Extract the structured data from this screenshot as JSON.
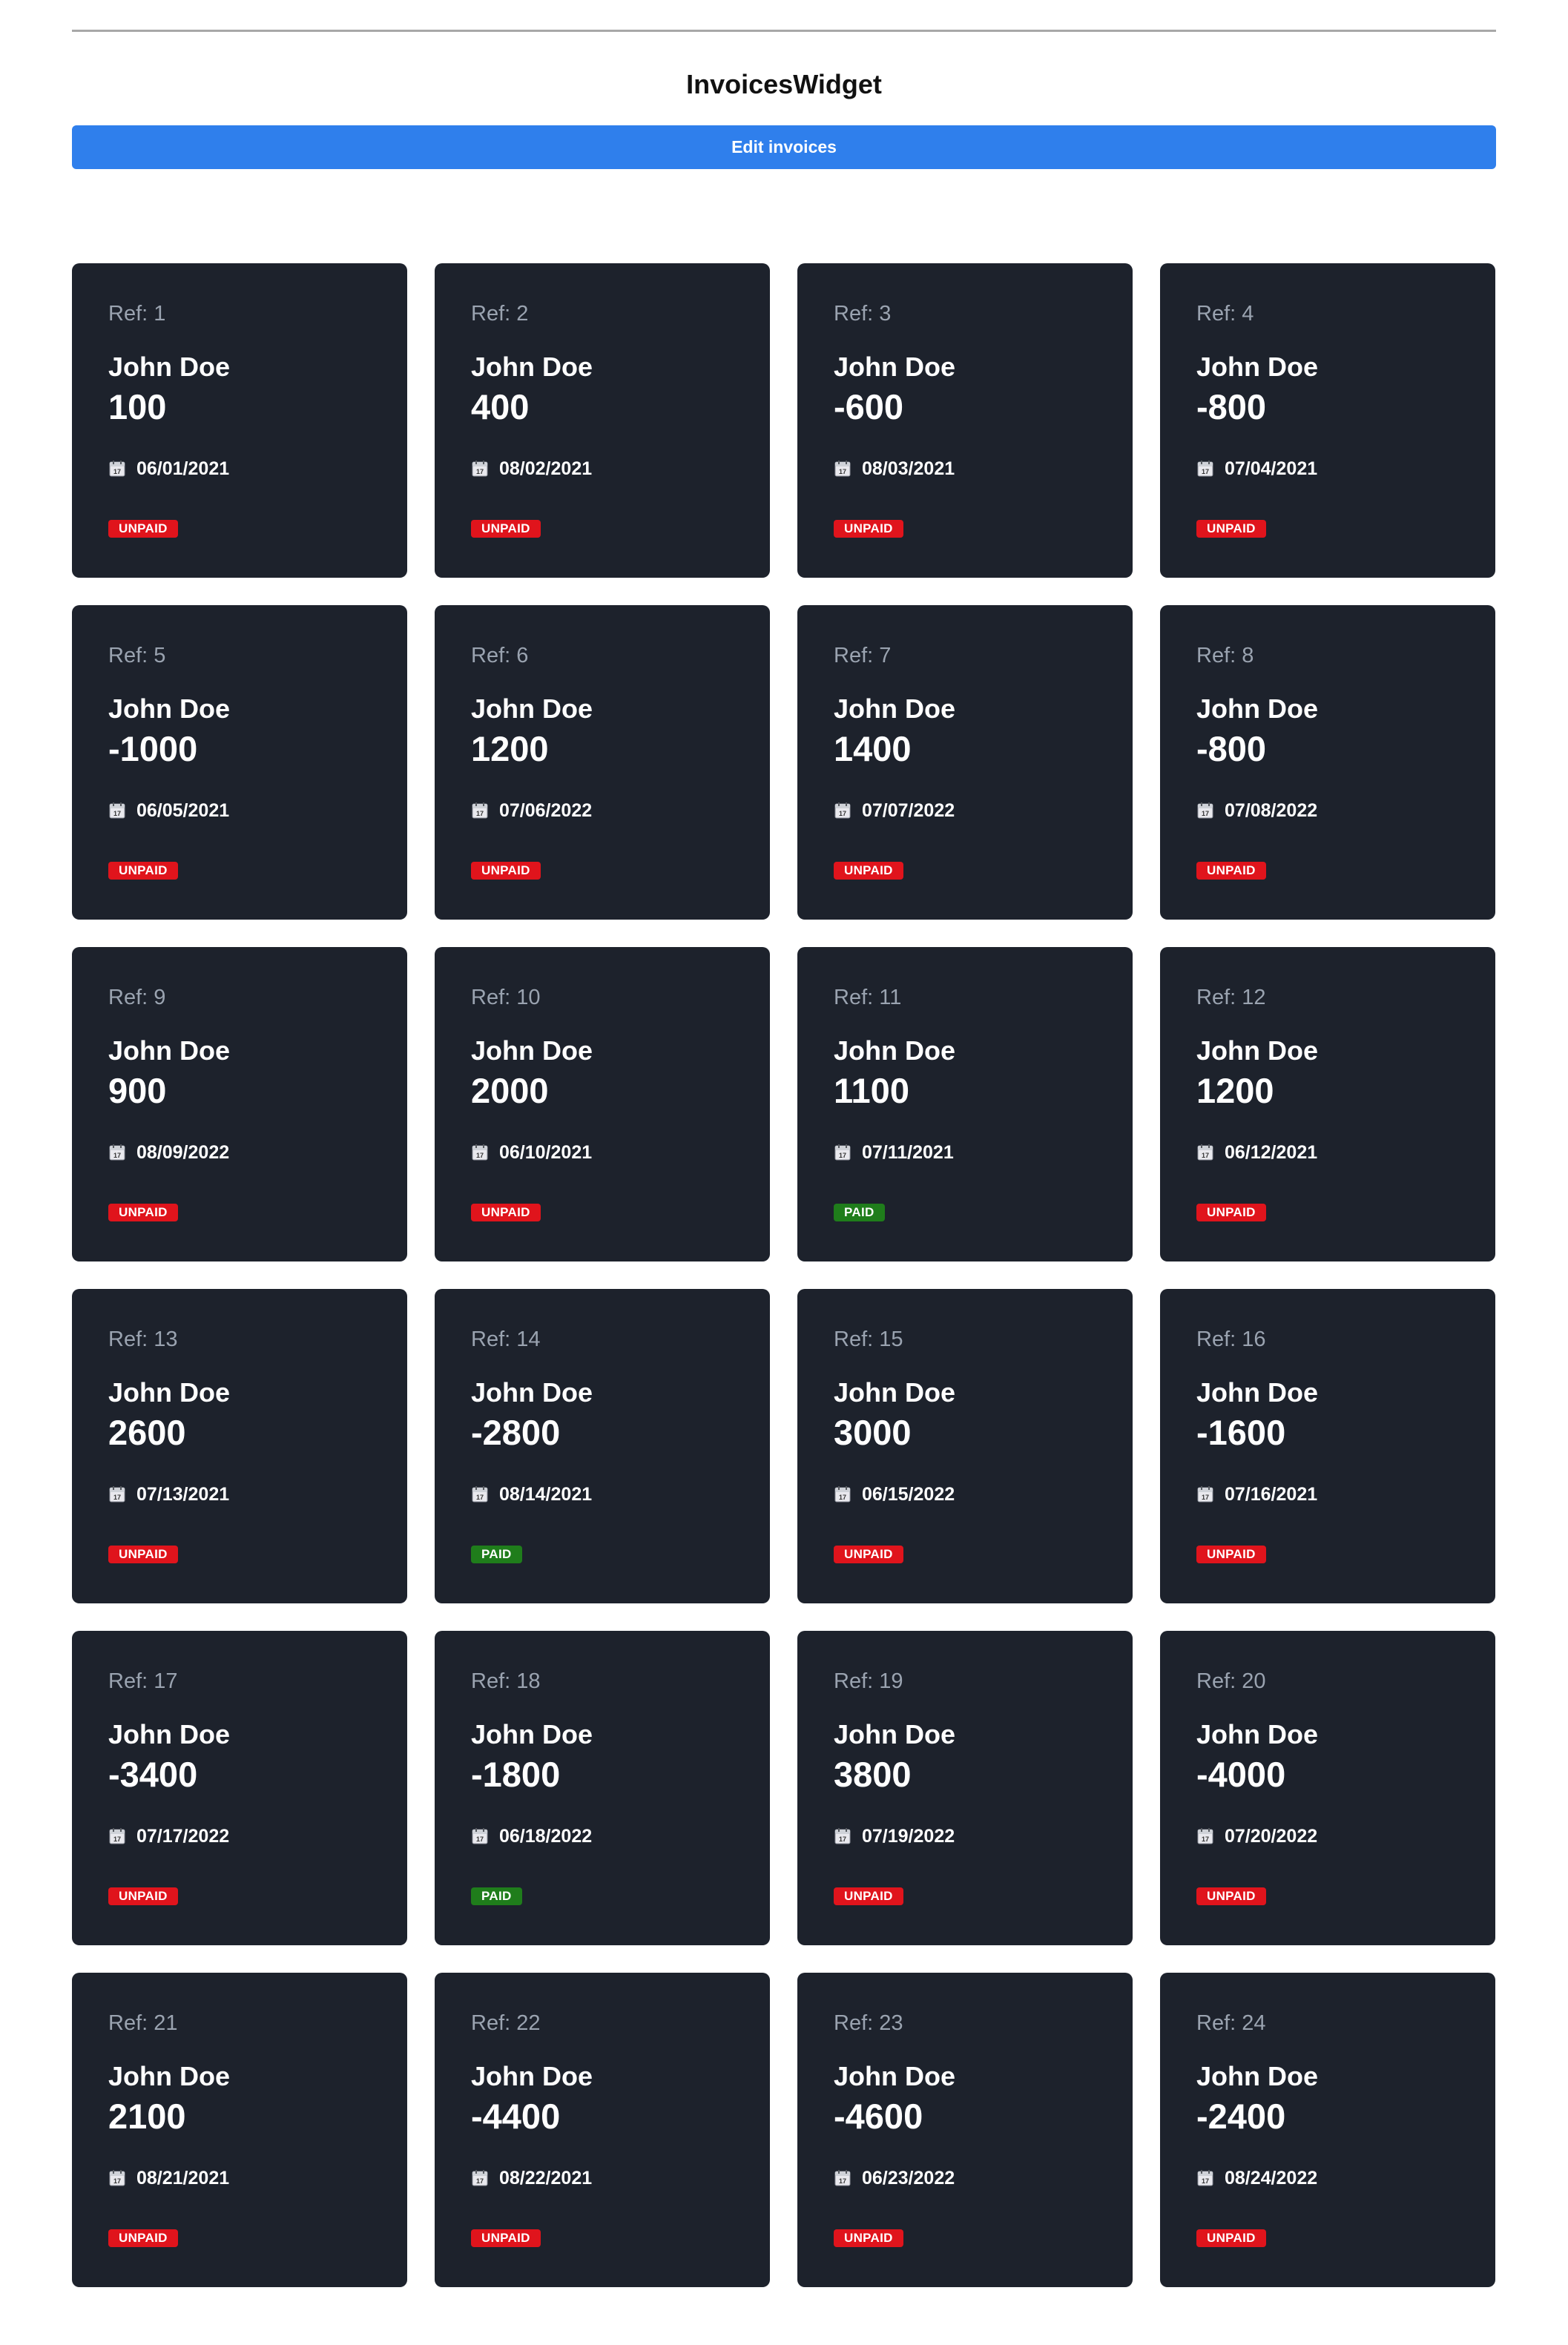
{
  "header": {
    "title": "InvoicesWidget",
    "edit_button_label": "Edit invoices"
  },
  "colors": {
    "accent": "#2f7fec",
    "card_background": "#1d222c",
    "unpaid": "#e0141c",
    "paid": "#1f7d1b"
  },
  "icons": {
    "date": "calendar-icon"
  },
  "invoices": [
    {
      "ref": "Ref: 1",
      "name": "John Doe",
      "amount": "100",
      "date": "06/01/2021",
      "status": "UNPAID"
    },
    {
      "ref": "Ref: 2",
      "name": "John Doe",
      "amount": "400",
      "date": "08/02/2021",
      "status": "UNPAID"
    },
    {
      "ref": "Ref: 3",
      "name": "John Doe",
      "amount": "-600",
      "date": "08/03/2021",
      "status": "UNPAID"
    },
    {
      "ref": "Ref: 4",
      "name": "John Doe",
      "amount": "-800",
      "date": "07/04/2021",
      "status": "UNPAID"
    },
    {
      "ref": "Ref: 5",
      "name": "John Doe",
      "amount": "-1000",
      "date": "06/05/2021",
      "status": "UNPAID"
    },
    {
      "ref": "Ref: 6",
      "name": "John Doe",
      "amount": "1200",
      "date": "07/06/2022",
      "status": "UNPAID"
    },
    {
      "ref": "Ref: 7",
      "name": "John Doe",
      "amount": "1400",
      "date": "07/07/2022",
      "status": "UNPAID"
    },
    {
      "ref": "Ref: 8",
      "name": "John Doe",
      "amount": "-800",
      "date": "07/08/2022",
      "status": "UNPAID"
    },
    {
      "ref": "Ref: 9",
      "name": "John Doe",
      "amount": "900",
      "date": "08/09/2022",
      "status": "UNPAID"
    },
    {
      "ref": "Ref: 10",
      "name": "John Doe",
      "amount": "2000",
      "date": "06/10/2021",
      "status": "UNPAID"
    },
    {
      "ref": "Ref: 11",
      "name": "John Doe",
      "amount": "1100",
      "date": "07/11/2021",
      "status": "PAID"
    },
    {
      "ref": "Ref: 12",
      "name": "John Doe",
      "amount": "1200",
      "date": "06/12/2021",
      "status": "UNPAID"
    },
    {
      "ref": "Ref: 13",
      "name": "John Doe",
      "amount": "2600",
      "date": "07/13/2021",
      "status": "UNPAID"
    },
    {
      "ref": "Ref: 14",
      "name": "John Doe",
      "amount": "-2800",
      "date": "08/14/2021",
      "status": "PAID"
    },
    {
      "ref": "Ref: 15",
      "name": "John Doe",
      "amount": "3000",
      "date": "06/15/2022",
      "status": "UNPAID"
    },
    {
      "ref": "Ref: 16",
      "name": "John Doe",
      "amount": "-1600",
      "date": "07/16/2021",
      "status": "UNPAID"
    },
    {
      "ref": "Ref: 17",
      "name": "John Doe",
      "amount": "-3400",
      "date": "07/17/2022",
      "status": "UNPAID"
    },
    {
      "ref": "Ref: 18",
      "name": "John Doe",
      "amount": "-1800",
      "date": "06/18/2022",
      "status": "PAID"
    },
    {
      "ref": "Ref: 19",
      "name": "John Doe",
      "amount": "3800",
      "date": "07/19/2022",
      "status": "UNPAID"
    },
    {
      "ref": "Ref: 20",
      "name": "John Doe",
      "amount": "-4000",
      "date": "07/20/2022",
      "status": "UNPAID"
    },
    {
      "ref": "Ref: 21",
      "name": "John Doe",
      "amount": "2100",
      "date": "08/21/2021",
      "status": "UNPAID"
    },
    {
      "ref": "Ref: 22",
      "name": "John Doe",
      "amount": "-4400",
      "date": "08/22/2021",
      "status": "UNPAID"
    },
    {
      "ref": "Ref: 23",
      "name": "John Doe",
      "amount": "-4600",
      "date": "06/23/2022",
      "status": "UNPAID"
    },
    {
      "ref": "Ref: 24",
      "name": "John Doe",
      "amount": "-2400",
      "date": "08/24/2022",
      "status": "UNPAID"
    }
  ]
}
